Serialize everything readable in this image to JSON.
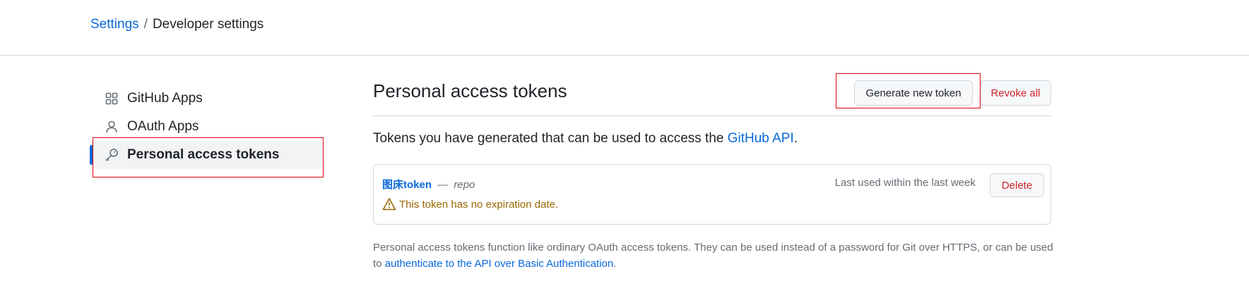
{
  "breadcrumb": {
    "settings": "Settings",
    "separator": "/",
    "current": "Developer settings"
  },
  "sidebar": {
    "items": [
      {
        "label": "GitHub Apps",
        "icon": "apps-grid-icon"
      },
      {
        "label": "OAuth Apps",
        "icon": "person-icon"
      },
      {
        "label": "Personal access tokens",
        "icon": "key-icon",
        "active": true
      }
    ]
  },
  "main": {
    "title": "Personal access tokens",
    "generate_label": "Generate new token",
    "revoke_label": "Revoke all",
    "intro_text": "Tokens you have generated that can be used to access the ",
    "intro_link": "GitHub API",
    "intro_end": ".",
    "token": {
      "name": "图床token",
      "separator": "—",
      "scope": "repo",
      "warning": "This token has no expiration date.",
      "last_used": "Last used within the last week",
      "delete_label": "Delete"
    },
    "footer_text": "Personal access tokens function like ordinary OAuth access tokens. They can be used instead of a password for Git over HTTPS, or can be used to ",
    "footer_link": "authenticate to the API over Basic Authentication",
    "footer_end": "."
  },
  "colors": {
    "link": "#0969da",
    "danger": "#cf222e",
    "warning": "#9a6700",
    "highlight_box": "#e5000d",
    "active_indicator": "#0969da"
  }
}
